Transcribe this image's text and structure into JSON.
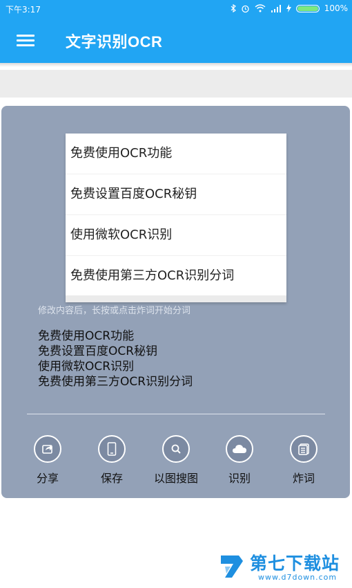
{
  "status": {
    "time": "下午3:17",
    "battery": "100%"
  },
  "appbar": {
    "title": "文字识别OCR"
  },
  "popup": {
    "items": [
      "免费使用OCR功能",
      "免费设置百度OCR秘钥",
      "使用微软OCR识别",
      "免费使用第三方OCR识别分词"
    ]
  },
  "dialog": {
    "hint": "修改内容后，长按或点击炸词开始分词",
    "lines": [
      "免费使用OCR功能",
      "免费设置百度OCR秘钥",
      "使用微软OCR识别",
      "免费使用第三方OCR识别分词"
    ],
    "actions": [
      {
        "label": "分享",
        "icon": "share-icon"
      },
      {
        "label": "保存",
        "icon": "phone-icon"
      },
      {
        "label": "以图搜图",
        "icon": "search-icon"
      },
      {
        "label": "识别",
        "icon": "cloud-icon"
      },
      {
        "label": "炸词",
        "icon": "notes-icon"
      }
    ]
  },
  "watermark": {
    "title": "第七下载站",
    "url": "www.d7down.com"
  },
  "colors": {
    "primary": "#21a5f3",
    "dialog_bg": "#93a1b7"
  }
}
